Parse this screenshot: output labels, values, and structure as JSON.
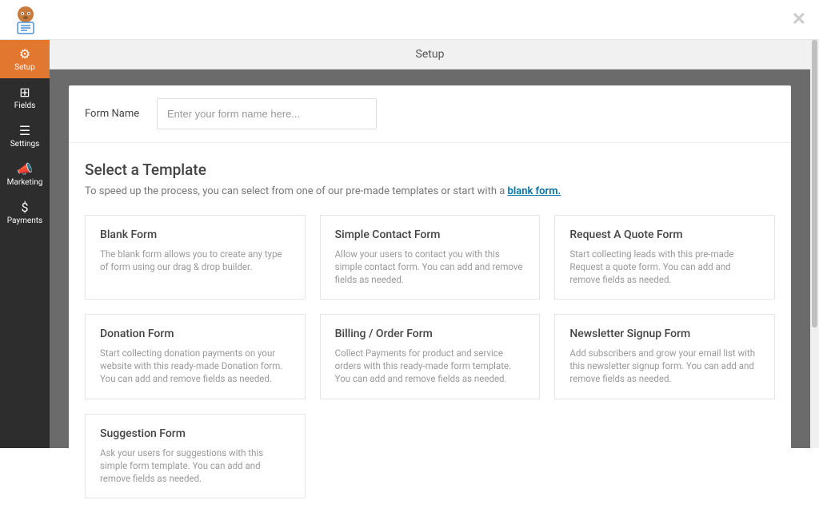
{
  "header": {
    "page_title": "Setup"
  },
  "sidebar": {
    "items": [
      {
        "label": "Setup",
        "icon": "⚙"
      },
      {
        "label": "Fields",
        "icon": "⊞"
      },
      {
        "label": "Settings",
        "icon": "☰"
      },
      {
        "label": "Marketing",
        "icon": "📣"
      },
      {
        "label": "Payments",
        "icon": "$"
      }
    ]
  },
  "form_name": {
    "label": "Form Name",
    "placeholder": "Enter your form name here..."
  },
  "templates": {
    "heading": "Select a Template",
    "subtext_prefix": "To speed up the process, you can select from one of our pre-made templates or start with a ",
    "subtext_link": "blank form.",
    "items": [
      {
        "title": "Blank Form",
        "desc": "The blank form allows you to create any type of form using our drag & drop builder."
      },
      {
        "title": "Simple Contact Form",
        "desc": "Allow your users to contact you with this simple contact form. You can add and remove fields as needed."
      },
      {
        "title": "Request A Quote Form",
        "desc": "Start collecting leads with this pre-made Request a quote form. You can add and remove fields as needed."
      },
      {
        "title": "Donation Form",
        "desc": "Start collecting donation payments on your website with this ready-made Donation form. You can add and remove fields as needed."
      },
      {
        "title": "Billing / Order Form",
        "desc": "Collect Payments for product and service orders with this ready-made form template. You can add and remove fields as needed."
      },
      {
        "title": "Newsletter Signup Form",
        "desc": "Add subscribers and grow your email list with this newsletter signup form. You can add and remove fields as needed."
      },
      {
        "title": "Suggestion Form",
        "desc": "Ask your users for suggestions with this simple form template. You can add and remove fields as needed."
      }
    ]
  }
}
